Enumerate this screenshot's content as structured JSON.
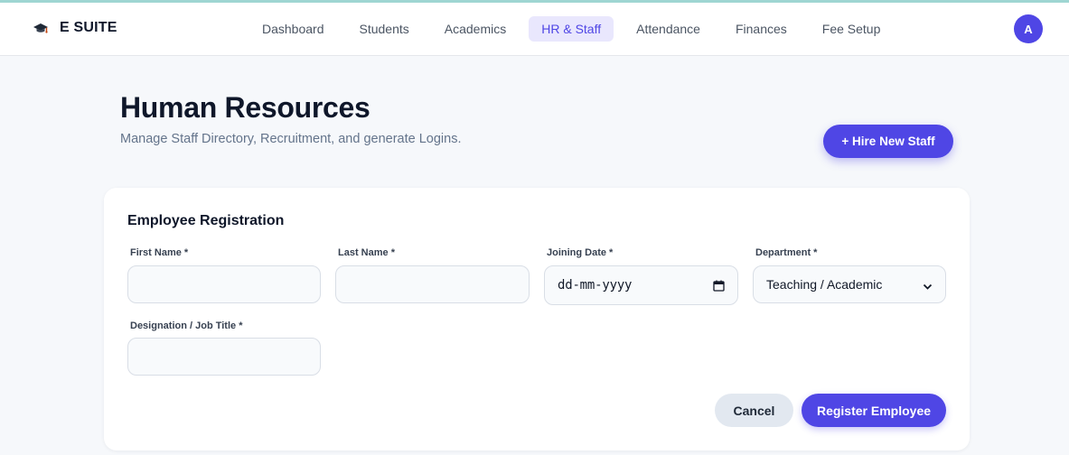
{
  "brand": {
    "name": "E SUITE",
    "icon": "graduation-cap-icon"
  },
  "nav": {
    "items": [
      {
        "label": "Dashboard"
      },
      {
        "label": "Students"
      },
      {
        "label": "Academics"
      },
      {
        "label": "HR & Staff",
        "active": true
      },
      {
        "label": "Attendance"
      },
      {
        "label": "Finances"
      },
      {
        "label": "Fee Setup"
      }
    ],
    "avatar_initial": "A"
  },
  "header": {
    "title": "Human Resources",
    "subtitle": "Manage Staff Directory, Recruitment, and generate Logins.",
    "hire_button": "+ Hire New Staff"
  },
  "form": {
    "title": "Employee Registration",
    "first_name": {
      "label": "First Name *",
      "value": ""
    },
    "last_name": {
      "label": "Last Name *",
      "value": ""
    },
    "joining_date": {
      "label": "Joining Date *",
      "placeholder": "dd-mm-yyyy"
    },
    "department": {
      "label": "Department *",
      "selected": "Teaching / Academic"
    },
    "designation": {
      "label": "Designation / Job Title *",
      "value": ""
    },
    "cancel_label": "Cancel",
    "register_label": "Register Employee"
  },
  "colors": {
    "accent": "#4f46e5",
    "nav_active_bg": "#e9e7fd",
    "page_bg": "#f6f8fb"
  }
}
